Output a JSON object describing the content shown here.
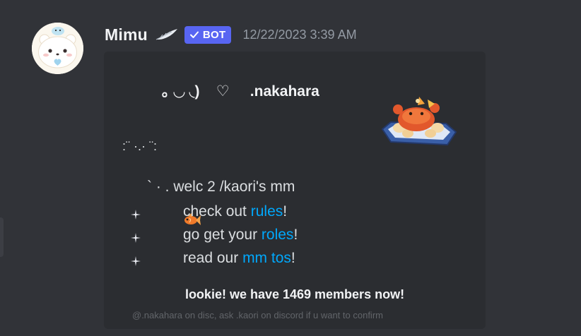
{
  "message": {
    "username": "Mimu",
    "bot_tag": "BOT",
    "timestamp": "12/22/2023 3:39 AM"
  },
  "embed": {
    "title": "｡ ◡ ◟)    ♡     .nakahara",
    "deco_line": ":¨ ·.· ¨:",
    "welcome_line": "` · . welc 2 /kaori's mm",
    "list": [
      {
        "prefix": "check out ",
        "link": "rules",
        "suffix": "!"
      },
      {
        "prefix": "go get your ",
        "link": "roles",
        "suffix": "!"
      },
      {
        "prefix": "read our ",
        "link": "mm tos",
        "suffix": "!"
      }
    ],
    "members_line": "lookie! we have 1469 members now!",
    "footer": "@.nakahara on disc, ask .kaori on discord if u want to confirm"
  },
  "colors": {
    "background": "#313338",
    "embed_bg": "#2b2d31",
    "bot_tag": "#5865f2",
    "link": "#00a8fc",
    "timestamp": "#949ba4"
  },
  "icons": {
    "avatar": "bear-avatar",
    "badge": "feather-icon",
    "bot_check": "checkmark-icon",
    "thumbnail": "crab-dish-icon",
    "fish": "goldfish-icon",
    "bullet": "sparkle-icon"
  }
}
